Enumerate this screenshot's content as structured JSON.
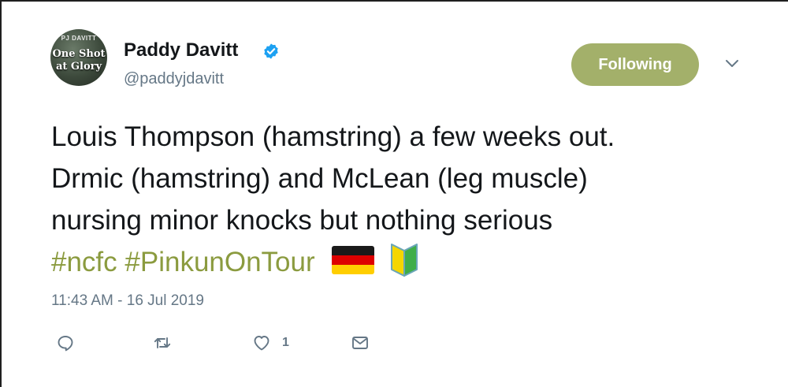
{
  "author": {
    "name": "Paddy Davitt",
    "handle": "@paddyjdavitt",
    "avatar": {
      "top_text": "PJ DAVITT",
      "line1": "One Shot",
      "line2": "at Glory"
    },
    "verified_icon": "verified-badge-icon"
  },
  "follow_button": {
    "label": "Following",
    "color": "#a3b06a"
  },
  "menu_icon": "chevron-down-icon",
  "tweet": {
    "line1": "Louis Thompson (hamstring) a few weeks out.",
    "line2": "Drmic (hamstring) and McLean (leg muscle)",
    "line3": "nursing minor knocks but nothing serious",
    "hashtag1": "#ncfc",
    "hashtag2": "#PinkunOnTour",
    "emojis": [
      "germany-flag-icon",
      "japanese-beginner-symbol-icon"
    ],
    "hashtag_color": "#8b9b3f"
  },
  "timestamp": "11:43 AM - 16 Jul 2019",
  "actions": {
    "reply_icon": "reply-icon",
    "retweet_icon": "retweet-icon",
    "like_icon": "heart-icon",
    "like_count": "1",
    "dm_icon": "envelope-icon"
  }
}
